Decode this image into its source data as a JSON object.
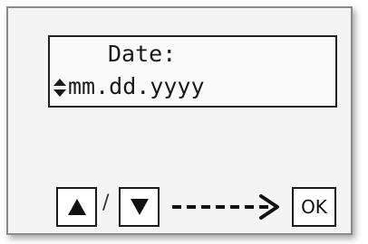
{
  "lcd": {
    "title": "Date:",
    "value": "mm.dd.yyyy",
    "cursor_icon": "up-down-arrows-icon"
  },
  "controls": {
    "up_icon": "up-triangle-icon",
    "separator": "/",
    "down_icon": "down-triangle-icon",
    "arrow_icon": "dashed-right-arrow-icon",
    "ok_label": "OK"
  }
}
